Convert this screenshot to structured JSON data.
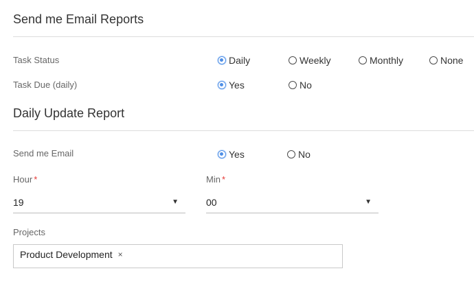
{
  "email_reports": {
    "title": "Send me Email Reports",
    "task_status": {
      "label": "Task Status",
      "options": [
        "Daily",
        "Weekly",
        "Monthly",
        "None"
      ],
      "selected": "Daily"
    },
    "task_due": {
      "label": "Task Due (daily)",
      "options": [
        "Yes",
        "No"
      ],
      "selected": "Yes"
    }
  },
  "daily_update": {
    "title": "Daily Update Report",
    "send_email": {
      "label": "Send me Email",
      "options": [
        "Yes",
        "No"
      ],
      "selected": "Yes"
    },
    "hour": {
      "label": "Hour",
      "required_mark": "*",
      "value": "19"
    },
    "min": {
      "label": "Min",
      "required_mark": "*",
      "value": "00"
    },
    "projects": {
      "label": "Projects",
      "chips": [
        "Product Development"
      ],
      "remove_glyph": "×"
    }
  },
  "icons": {
    "dropdown": "▼"
  },
  "colors": {
    "accent": "#4f8fe6",
    "required": "#e53935"
  }
}
